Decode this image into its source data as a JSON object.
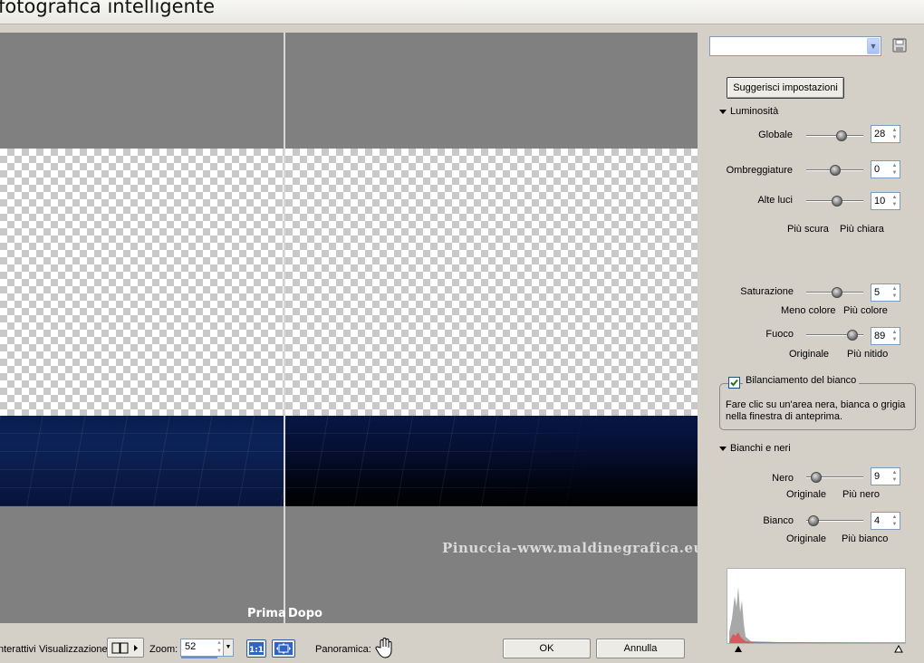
{
  "window": {
    "title": "fotografica intelligente"
  },
  "preview": {
    "before_label": "Prima",
    "after_label": "Dopo",
    "watermark": "Pinuccia-www.maldinegrafica.eu"
  },
  "toolbar": {
    "interactive_label": "nterattivi",
    "view_label": "Visualizzazione:",
    "zoom_label": "Zoom:",
    "zoom_value": "52",
    "pan_label": "Panoramica:",
    "actual_size_label": "1:1",
    "ok_label": "OK",
    "cancel_label": "Annulla"
  },
  "panel": {
    "preset_value": "",
    "suggest_label": "Suggerisci impostazioni",
    "brightness": {
      "title": "Luminosità",
      "global": {
        "label": "Globale",
        "value": "28",
        "level": 0.64
      },
      "shadows": {
        "label": "Ombreggiature",
        "value": "0",
        "level": 0.5
      },
      "highlights": {
        "label": "Alte luci",
        "value": "10",
        "level": 0.54
      },
      "darker_label": "Più scura",
      "lighter_label": "Più chiara"
    },
    "saturation": {
      "label": "Saturazione",
      "value": "5",
      "level": 0.55,
      "less_label": "Meno colore",
      "more_label": "Più colore"
    },
    "focus": {
      "label": "Fuoco",
      "value": "89",
      "level": 0.89,
      "original_label": "Originale",
      "sharper_label": "Più nitido"
    },
    "white_balance": {
      "label": "Bilanciamento del bianco",
      "checked": true,
      "description": "Fare clic su un'area nera, bianca o grigia nella finestra di anteprima."
    },
    "blacks_whites": {
      "title": "Bianchi e neri",
      "black": {
        "label": "Nero",
        "value": "9",
        "level": 0.09,
        "original_label": "Originale",
        "more_label": "Più nero"
      },
      "white": {
        "label": "Bianco",
        "value": "4",
        "level": 0.04,
        "original_label": "Originale",
        "more_label": "Più bianco"
      }
    }
  },
  "colors": {
    "accent": "#316ac5",
    "histogram_gray": "#a8a8a8",
    "histogram_red": "#d9595f"
  }
}
